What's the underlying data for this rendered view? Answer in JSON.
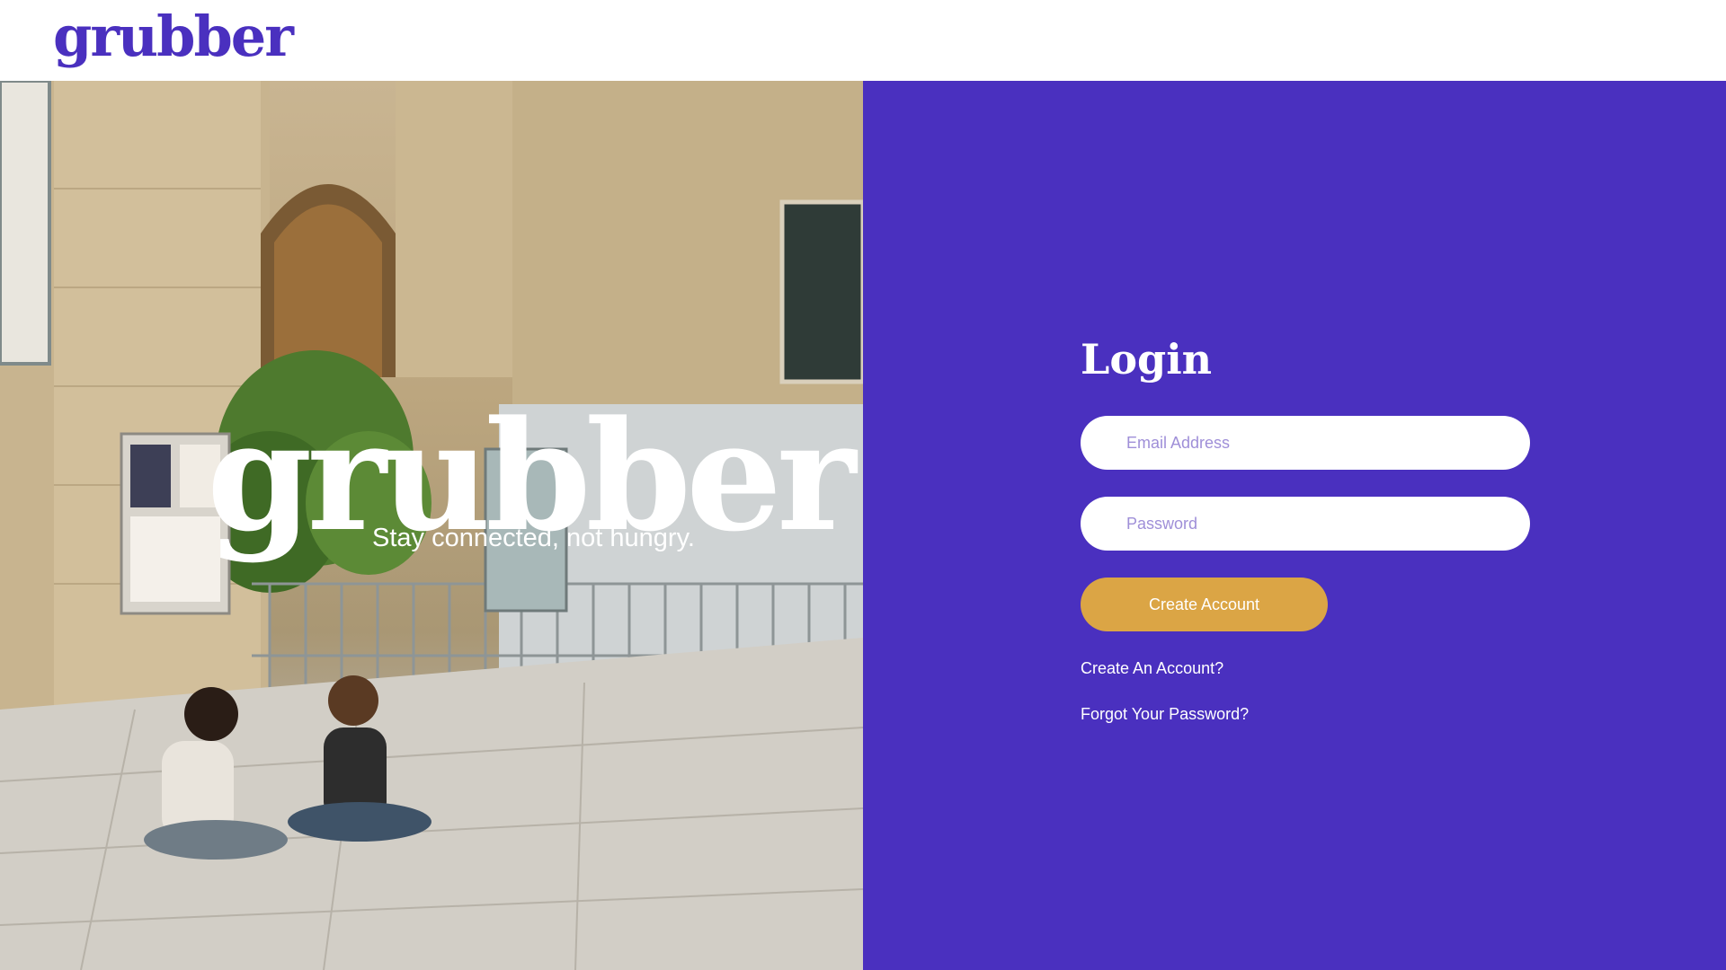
{
  "header": {
    "logo_text": "grubber"
  },
  "hero": {
    "wordmark": "grubber",
    "tagline": "Stay connected, not hungry."
  },
  "login": {
    "title": "Login",
    "email_placeholder": "Email Address",
    "password_placeholder": "Password",
    "submit_label": "Create Account",
    "create_link": "Create An Account?",
    "forgot_link": "Forgot Your Password?"
  },
  "colors": {
    "brand": "#4a30bf",
    "accent": "#dba545",
    "text_on_brand": "#ffffff"
  }
}
